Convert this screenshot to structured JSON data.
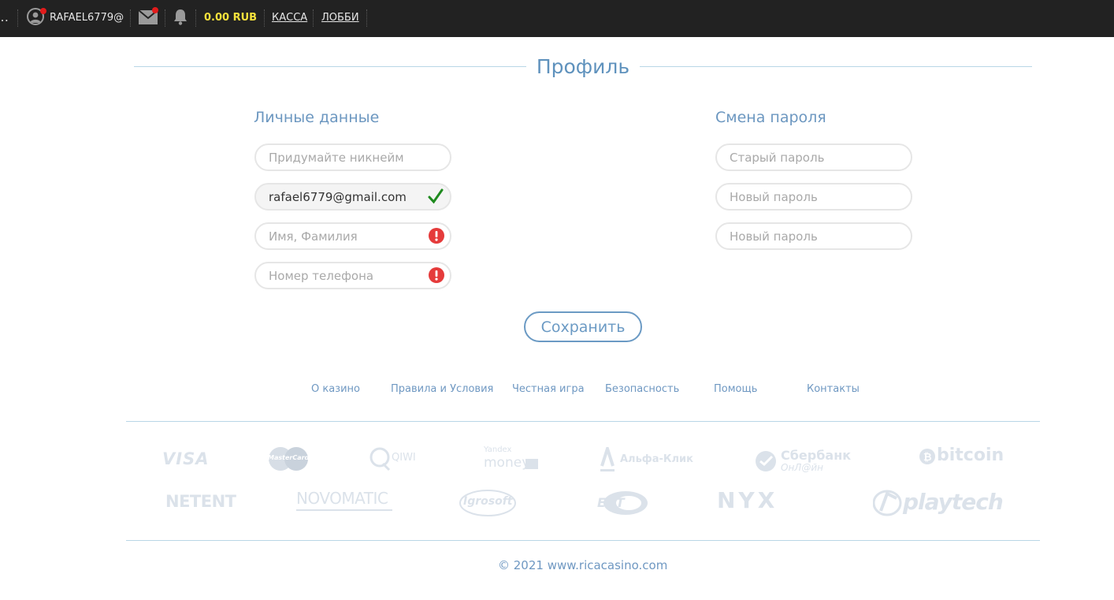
{
  "topbar": {
    "cut_glyph": "…",
    "username": "RAFAEL6779@",
    "balance": "0.00 RUB",
    "links": {
      "kassa": "КАССА",
      "lobby": "ЛОББИ"
    },
    "icons": [
      "user-avatar-icon",
      "mail-icon",
      "bell-icon"
    ],
    "colors": {
      "bar_bg": "#222222",
      "balance": "#f5e13c",
      "notification_dot": "#e21b1b"
    }
  },
  "page": {
    "title": "Профиль"
  },
  "personal": {
    "title": "Личные данные",
    "nickname_placeholder": "Придумайте никнейм",
    "email_value": "rafael6779@gmail.com",
    "name_placeholder": "Имя, Фамилия",
    "phone_placeholder": "Номер телефона"
  },
  "password": {
    "title": "Смена пароля",
    "old_placeholder": "Старый пароль",
    "new_placeholder": "Новый пароль",
    "repeat_placeholder": "Новый пароль"
  },
  "save_label": "Сохранить",
  "footer": {
    "links": [
      "О казино",
      "Правила и Условия",
      "Честная игра",
      "Безопасность",
      "Помощь",
      "Контакты"
    ],
    "payment_logos": {
      "visa": "VISA",
      "mastercard": "MasterCard",
      "qiwi": "QIWI",
      "yandex_top": "Yandex",
      "yandex_bottom": "money",
      "alfa": "Альфа-Клик",
      "sber_top": "Сбербанк",
      "sber_bottom": "ОнЛ@йн",
      "bitcoin": "bitcoin"
    },
    "provider_logos": {
      "netent": "NETENT",
      "novomatic": "NOVOMATIC",
      "igrosoft": "Igrosoft",
      "egt": "EGT",
      "nyx": "NYX",
      "playtech": "playtech"
    },
    "copyright": "© 2021 www.ricacasino.com"
  },
  "colors": {
    "accent": "#6b9ac4",
    "success_check": "#1e8a1e",
    "error_icon": "#e53b3b",
    "divider": "#b9d6e6",
    "logo_gray": "#dbe2ea"
  }
}
